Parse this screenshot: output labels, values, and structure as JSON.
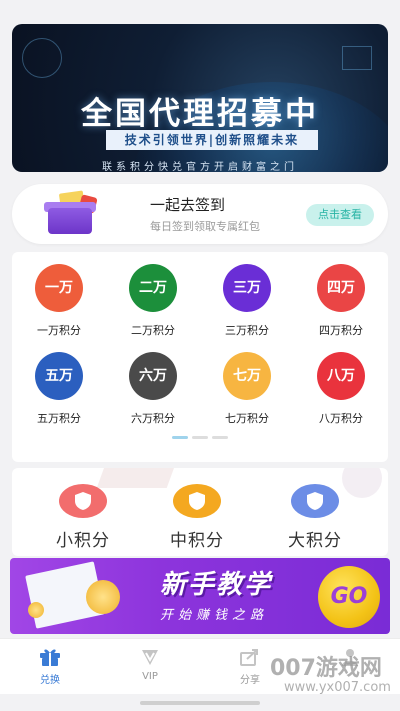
{
  "banner": {
    "title": "全国代理招募中",
    "subtitle": "技术引领世界|创新照耀未来",
    "slogan": "联系积分快兑官方开启财富之门"
  },
  "signin": {
    "title": "一起去签到",
    "desc": "每日签到领取专属红包",
    "button": "点击查看"
  },
  "points": [
    {
      "badge": "一万",
      "label": "一万积分",
      "color": "#ee5d3b"
    },
    {
      "badge": "二万",
      "label": "二万积分",
      "color": "#1c8f3b"
    },
    {
      "badge": "三万",
      "label": "三万积分",
      "color": "#6a2ed6"
    },
    {
      "badge": "四万",
      "label": "四万积分",
      "color": "#ea4545"
    },
    {
      "badge": "五万",
      "label": "五万积分",
      "color": "#2b5fbf"
    },
    {
      "badge": "六万",
      "label": "六万积分",
      "color": "#4a4a4a"
    },
    {
      "badge": "七万",
      "label": "七万积分",
      "color": "#f7b541"
    },
    {
      "badge": "八万",
      "label": "八万积分",
      "color": "#e9333d"
    }
  ],
  "tiers": [
    {
      "name": "小积分",
      "color": "#f26d6d"
    },
    {
      "name": "中积分",
      "color": "#f4a820"
    },
    {
      "name": "大积分",
      "color": "#6c8de6"
    }
  ],
  "tutorial": {
    "title": "新手教学",
    "subtitle": "开始赚钱之路",
    "go": "GO"
  },
  "tabs": [
    {
      "label": "兑换",
      "icon": "gift-icon",
      "active": true
    },
    {
      "label": "VIP",
      "icon": "vip-icon",
      "active": false
    },
    {
      "label": "分享",
      "icon": "share-icon",
      "active": false
    },
    {
      "label": "",
      "icon": "user-icon",
      "active": false
    }
  ],
  "watermark": {
    "main": "007游戏网",
    "sub": "www.yx007.com"
  }
}
